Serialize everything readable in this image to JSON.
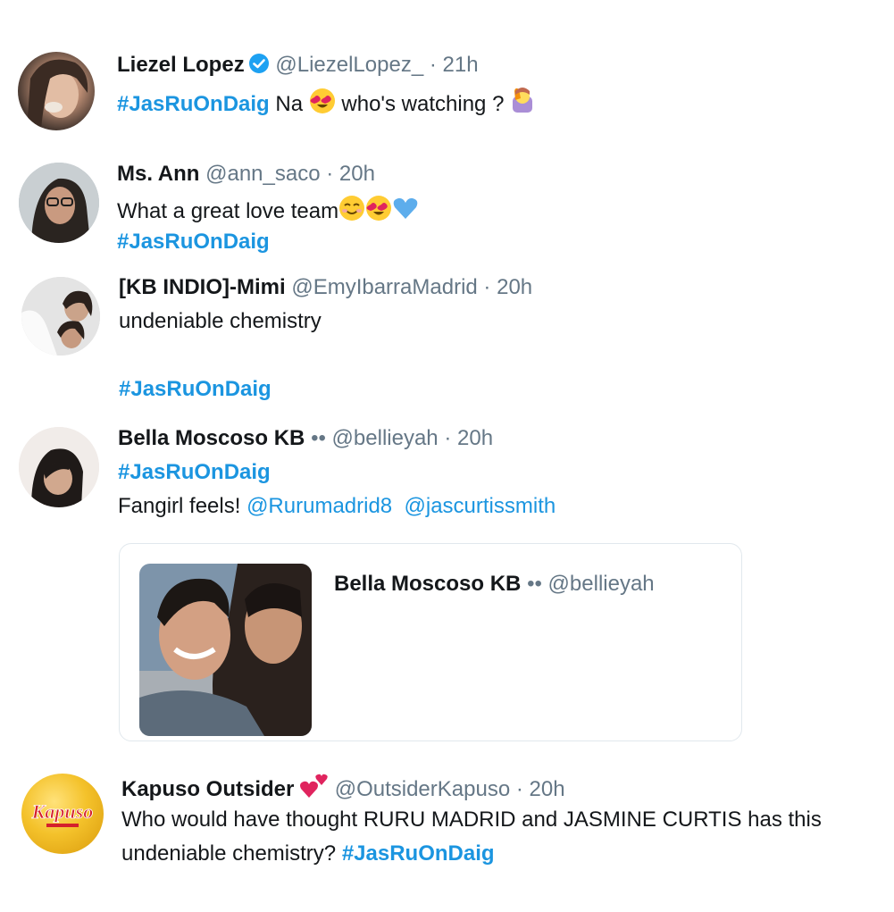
{
  "tweets": [
    {
      "name": "Liezel Lopez",
      "handle": "@LiezelLopez_",
      "dot": "·",
      "time": "21h",
      "hashtag": "#JasRuOnDaig",
      "text_after": " Na ",
      "text_tail": " who's watching ? "
    },
    {
      "name": "Ms. Ann",
      "handle": "@ann_saco",
      "dot": "·",
      "time": "20h",
      "text": "What a great love team",
      "hashtag": "#JasRuOnDaig"
    },
    {
      "name": "[KB INDIO]-Mimi",
      "handle": "@EmyIbarraMadrid",
      "dot": "·",
      "time": "20h",
      "text": "undeniable chemistry",
      "hashtag": "#JasRuOnDaig"
    },
    {
      "name": "Bella Moscoso KB",
      "name_suffix": "••",
      "handle": "@bellieyah",
      "dot": "·",
      "time": "20h",
      "hashtag": "#JasRuOnDaig",
      "text": "Fangirl feels! ",
      "mention1": "@Rurumadrid8",
      "mention2": "@jascurtissmith",
      "quote": {
        "name": "Bella Moscoso KB",
        "name_suffix": "••",
        "handle": "@bellieyah"
      }
    },
    {
      "name": "Kapuso Outsider",
      "handle": "@OutsiderKapuso",
      "dot": "·",
      "time": "20h",
      "text_line1": "Who would have thought RURU MADRID and JASMINE CURTIS has this",
      "text_line2": "undeniable chemistry? ",
      "hashtag": "#JasRuOnDaig",
      "logo_text": "Kapuso"
    }
  ],
  "colors": {
    "hashtag": "#1b95e0",
    "secondary": "#657786",
    "verified": "#1da1f2"
  },
  "icons": [
    "verified-badge-icon",
    "heart-eyes-emoji",
    "raising-hand-emoji",
    "smiling-emoji",
    "blue-heart-emoji",
    "two-hearts-emoji"
  ]
}
